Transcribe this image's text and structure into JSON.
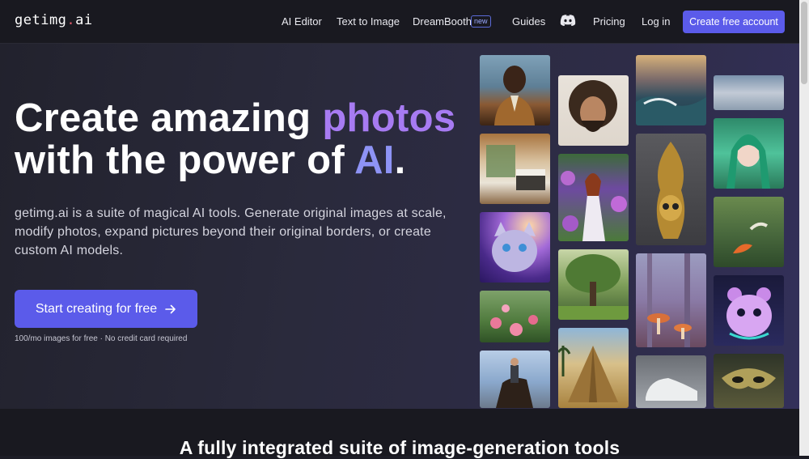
{
  "nav": {
    "logo_prefix": "getimg",
    "logo_dot": ".",
    "logo_suffix": "ai",
    "links": [
      "AI Editor",
      "Text to Image",
      "DreamBooth",
      "Guides",
      "Pricing",
      "Log in"
    ],
    "new_badge": "new",
    "cta": "Create free account"
  },
  "hero": {
    "headline_1": "Create amazing ",
    "headline_accent": "photos",
    "headline_2": "with the power of ",
    "headline_accent2": "AI",
    "headline_end": ".",
    "description": "getimg.ai is a suite of magical AI tools. Generate original images at scale, modify photos, expand pictures beyond their original borders, or create custom AI models.",
    "cta": "Start creating for free",
    "note": "100/mo images for free · No credit card required"
  },
  "section2": {
    "title": "A fully integrated suite of image-generation tools"
  },
  "colors": {
    "accent": "#5b5bea",
    "headline_accent": "#a77bf2",
    "background": "#1d1d26"
  }
}
